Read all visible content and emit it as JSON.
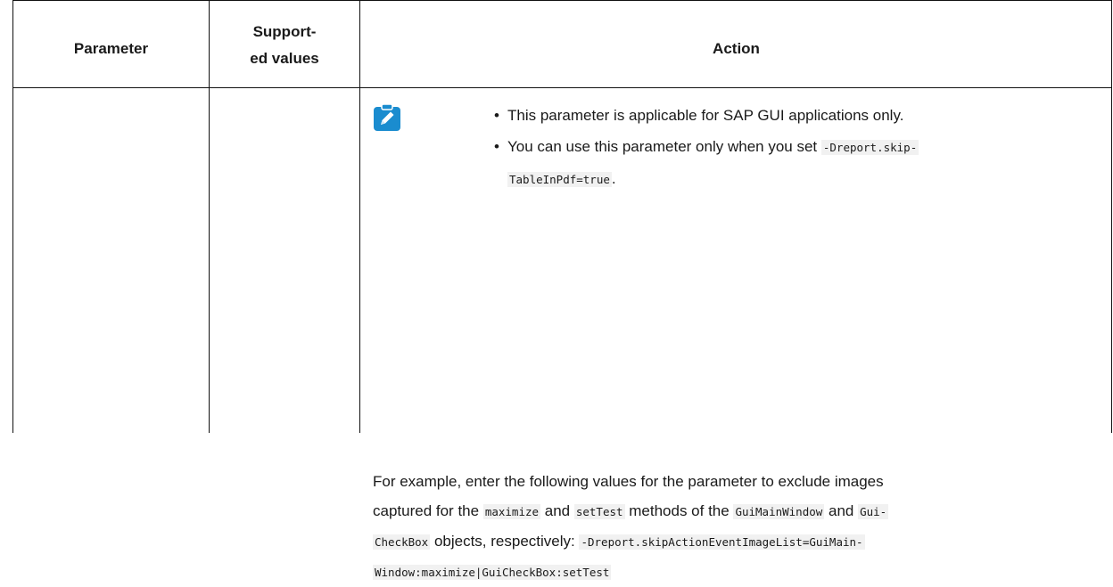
{
  "header": {
    "parameter": "Parameter",
    "supported_values_line1": "Support-",
    "supported_values_line2": "ed values",
    "action": "Action"
  },
  "note": {
    "icon": "note-pencil-icon",
    "icon_color": "#1a8ccf",
    "bullet1": "This parameter is applicable for SAP GUI applications only.",
    "bullet2_text": "You can use this parameter only when you set ",
    "bullet2_code_line1": "-Dreport.skip-",
    "bullet2_code_line2": "TableInPdf=true",
    "bullet2_end": "."
  },
  "example": {
    "line1": "For example, enter the following values for the parameter to exclude images",
    "line2_a": "captured for the ",
    "line2_code1": "maximize",
    "line2_b": " and ",
    "line2_code2": "setTest",
    "line2_c": " methods of the ",
    "line2_code3": "GuiMainWindow",
    "line2_d": " and ",
    "line2_code4": "Gui-",
    "line3_code1": "CheckBox",
    "line3_a": " objects, respectively: ",
    "line3_code2": "-Dreport.skipActionEventImageList=GuiMain-",
    "line4_code": "Window:maximize|GuiCheckBox:setTest"
  }
}
